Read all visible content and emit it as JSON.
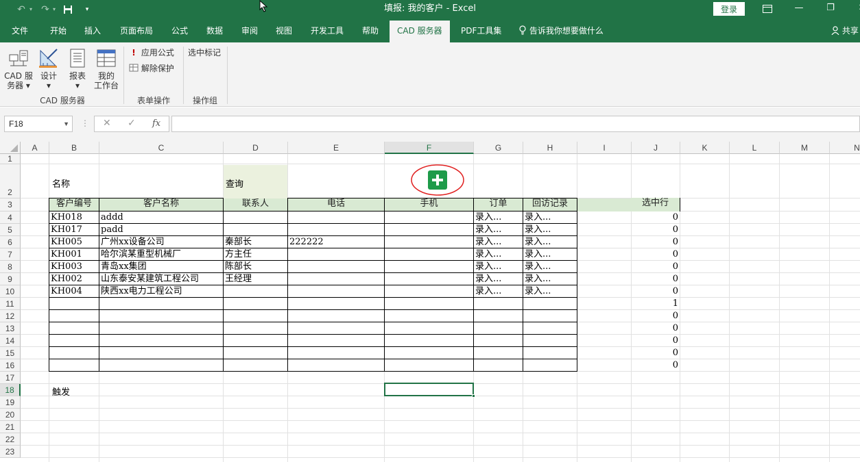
{
  "titlebar": {
    "title": "填报: 我的客户  -  Excel",
    "login": "登录",
    "minimize": "—",
    "restore": "❐",
    "close": "✕"
  },
  "tabs": [
    {
      "label": "文件"
    },
    {
      "label": "开始"
    },
    {
      "label": "插入"
    },
    {
      "label": "页面布局"
    },
    {
      "label": "公式"
    },
    {
      "label": "数据"
    },
    {
      "label": "审阅"
    },
    {
      "label": "视图"
    },
    {
      "label": "开发工具"
    },
    {
      "label": "帮助"
    },
    {
      "label": "CAD 服务器"
    },
    {
      "label": "PDF工具集"
    }
  ],
  "tellme": "告诉我你想要做什么",
  "share": "共享",
  "ribbon": {
    "cad_server_line1": "CAD 服",
    "cad_server_line2": "务器 ▾",
    "design_line1": "设计",
    "design_line2": "▾",
    "report_line1": "报表",
    "report_line2": "▾",
    "workbench_line1": "我的",
    "workbench_line2": "工作台",
    "apply_formula": "应用公式",
    "unprotect": "解除保护",
    "select_mark": "选中标记",
    "group_cad": "CAD 服务器",
    "group_form": "表单操作",
    "group_ops": "操作组"
  },
  "formula_bar": {
    "name_box": "F18",
    "cancel": "✕",
    "enter": "✓",
    "fx": "fx",
    "value": ""
  },
  "columns": [
    "A",
    "B",
    "C",
    "D",
    "E",
    "F",
    "G",
    "H",
    "I",
    "J",
    "K",
    "L",
    "M",
    "N"
  ],
  "rows": [
    "1",
    "2",
    "3",
    "4",
    "5",
    "6",
    "7",
    "8",
    "9",
    "10",
    "11",
    "12",
    "13",
    "14",
    "15",
    "16",
    "17",
    "18",
    "19",
    "20",
    "21",
    "22",
    "23"
  ],
  "sheet": {
    "label_name": "名称",
    "label_query": "查询",
    "label_trigger": "触发",
    "headers": [
      "客户编号",
      "客户名称",
      "联系人",
      "电话",
      "手机",
      "订单",
      "回访记录"
    ],
    "selected_header": "选中行",
    "records": [
      {
        "id": "KH018",
        "name": "addd",
        "contact": "",
        "phone": "",
        "mobile": "",
        "order": "录入...",
        "visit": "录入..."
      },
      {
        "id": "KH017",
        "name": "padd",
        "contact": "",
        "phone": "",
        "mobile": "",
        "order": "录入...",
        "visit": "录入..."
      },
      {
        "id": "KH005",
        "name": "广州xx设备公司",
        "contact": "秦部长",
        "phone": "222222",
        "mobile": "",
        "order": "录入...",
        "visit": "录入..."
      },
      {
        "id": "KH001",
        "name": "哈尔滨某重型机械厂",
        "contact": "方主任",
        "phone": "",
        "mobile": "",
        "order": "录入...",
        "visit": "录入..."
      },
      {
        "id": "KH003",
        "name": "青岛xx集团",
        "contact": "陈部长",
        "phone": "",
        "mobile": "",
        "order": "录入...",
        "visit": "录入..."
      },
      {
        "id": "KH002",
        "name": "山东泰安某建筑工程公司",
        "contact": "王经理",
        "phone": "",
        "mobile": "",
        "order": "录入...",
        "visit": "录入..."
      },
      {
        "id": "KH004",
        "name": "陕西xx电力工程公司",
        "contact": "",
        "phone": "",
        "mobile": "",
        "order": "录入...",
        "visit": "录入..."
      }
    ],
    "selected_values": [
      "0",
      "0",
      "0",
      "0",
      "0",
      "0",
      "0",
      "1",
      "0",
      "0",
      "0",
      "0",
      "0"
    ]
  }
}
